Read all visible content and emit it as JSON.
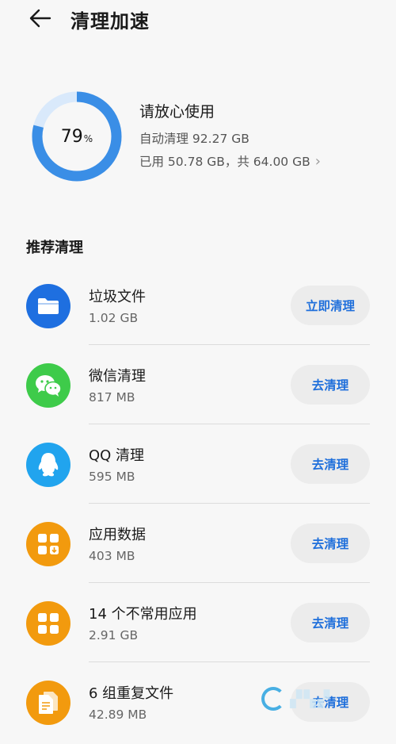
{
  "header": {
    "title": "清理加速",
    "back_icon": "arrow-left-icon"
  },
  "storage": {
    "percent": "79",
    "percent_unit": "%",
    "used_fraction": 0.79,
    "status": "请放心使用",
    "auto_clean": "自动清理 92.27 GB",
    "usage": "已用 50.78 GB，共 64.00 GB",
    "ring_color": "#3a8ee6",
    "ring_track_color": "#d9e9fb"
  },
  "section": {
    "title": "推荐清理"
  },
  "items": [
    {
      "name": "垃圾文件",
      "size": "1.02 GB",
      "button": "立即清理",
      "icon": "folder-icon",
      "color": "#1e6fe0"
    },
    {
      "name": "微信清理",
      "size": "817 MB",
      "button": "去清理",
      "icon": "wechat-icon",
      "color": "#3ecb4a"
    },
    {
      "name": "QQ 清理",
      "size": "595 MB",
      "button": "去清理",
      "icon": "qq-penguin-icon",
      "color": "#21a4ee"
    },
    {
      "name": "应用数据",
      "size": "403 MB",
      "button": "去清理",
      "icon": "app-data-icon",
      "color": "#f29a0e"
    },
    {
      "name": "14 个不常用应用",
      "size": "2.91 GB",
      "button": "去清理",
      "icon": "apps-grid-icon",
      "color": "#f29a0e"
    },
    {
      "name": "6 组重复文件",
      "size": "42.89 MB",
      "button": "去清理",
      "icon": "duplicate-files-icon",
      "color": "#f29a0e"
    }
  ]
}
